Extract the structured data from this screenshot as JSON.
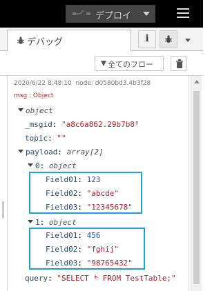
{
  "header": {
    "deploy_label": "デプロイ"
  },
  "tab": {
    "label": "デバッグ",
    "info_label": "i"
  },
  "toolbar": {
    "filter_label": "全てのフロー"
  },
  "message": {
    "timestamp": "2020/6/22 8:48:10",
    "node": "node: d0580bd3.4b3f28",
    "topic_line": "msg : Object",
    "root_type": "object",
    "msgid_key": "_msgid",
    "msgid_value": "\"a8c6a862.29b7b8\"",
    "topic_key": "topic",
    "topic_value": "\"\"",
    "payload_key": "payload",
    "payload_type": "array[2]",
    "items": [
      {
        "index": "0",
        "type": "object",
        "fields": [
          {
            "key": "Field01",
            "value": "123",
            "kind": "number"
          },
          {
            "key": "Field02",
            "value": "\"abcde\"",
            "kind": "string"
          },
          {
            "key": "Field03",
            "value": "\"12345678\"",
            "kind": "string"
          }
        ]
      },
      {
        "index": "1",
        "type": "object",
        "fields": [
          {
            "key": "Field01",
            "value": "456",
            "kind": "number"
          },
          {
            "key": "Field02",
            "value": "\"fghij\"",
            "kind": "string"
          },
          {
            "key": "Field03",
            "value": "\"98765432\"",
            "kind": "string"
          }
        ]
      }
    ],
    "query_key": "query",
    "query_value": "\"SELECT * FROM TestTable;\""
  },
  "colors": {
    "highlight": "#1ea0d8",
    "header": "#000000"
  },
  "icons": [
    "deploy-icon",
    "hamburger-menu-icon",
    "bug-icon",
    "info-icon",
    "filter-icon",
    "trash-icon",
    "caret-down-icon"
  ]
}
